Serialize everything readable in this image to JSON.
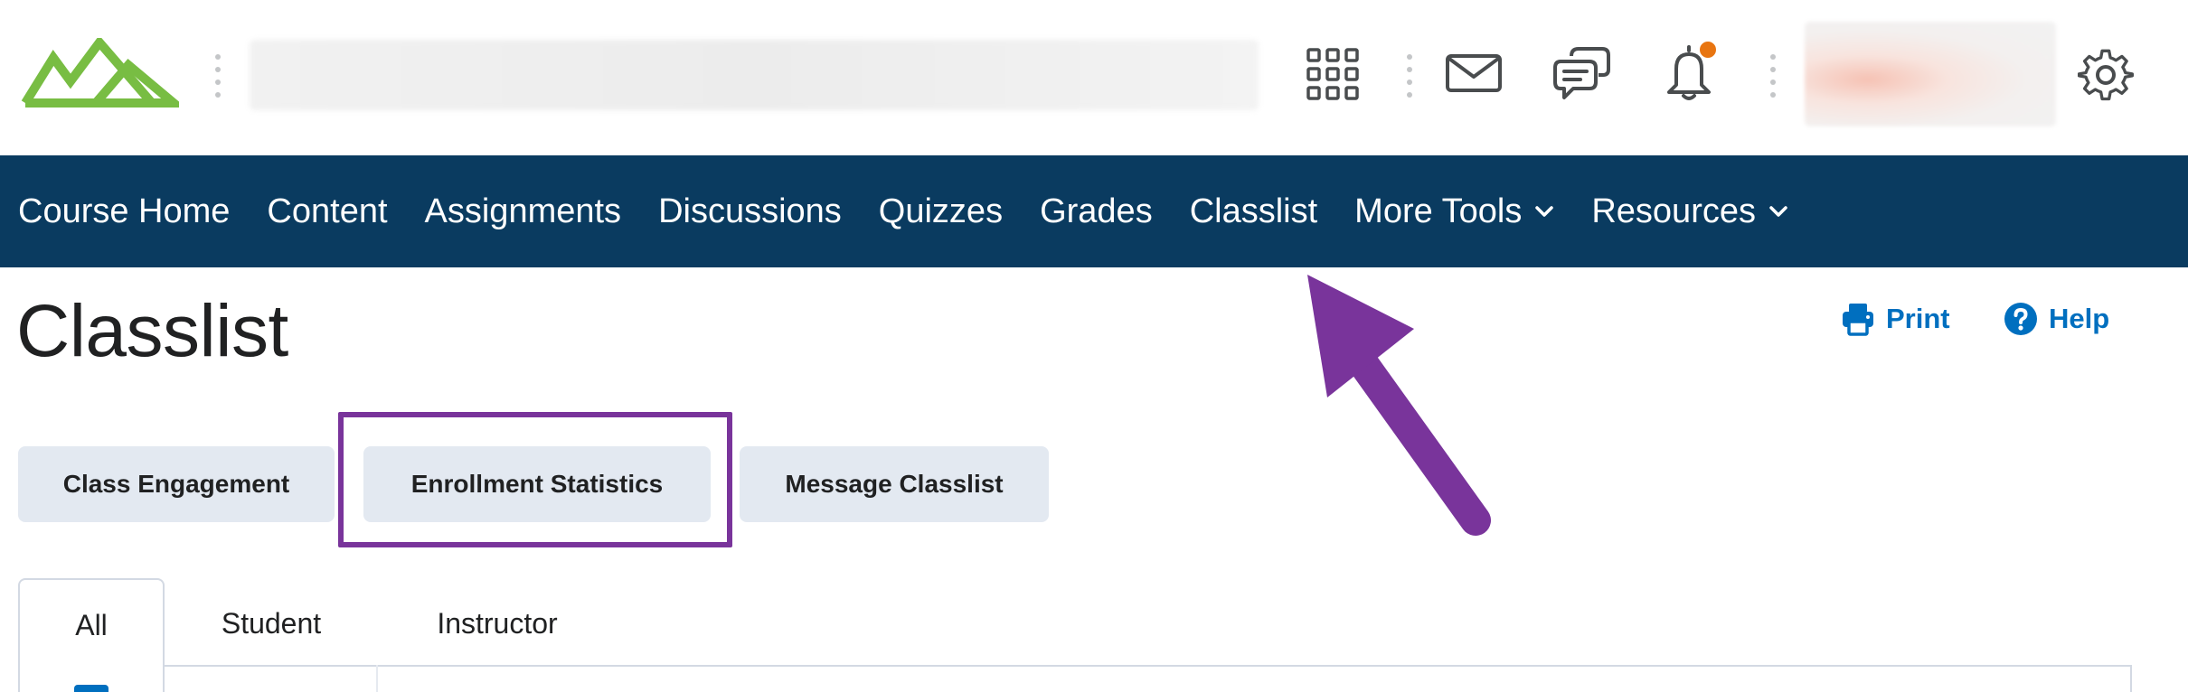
{
  "nav": {
    "items": [
      {
        "label": "Course Home",
        "dropdown": false
      },
      {
        "label": "Content",
        "dropdown": false
      },
      {
        "label": "Assignments",
        "dropdown": false
      },
      {
        "label": "Discussions",
        "dropdown": false
      },
      {
        "label": "Quizzes",
        "dropdown": false
      },
      {
        "label": "Grades",
        "dropdown": false
      },
      {
        "label": "Classlist",
        "dropdown": false
      },
      {
        "label": "More Tools",
        "dropdown": true
      },
      {
        "label": "Resources",
        "dropdown": true
      }
    ]
  },
  "page": {
    "title": "Classlist",
    "print_label": "Print",
    "help_label": "Help"
  },
  "actions": {
    "class_engagement": "Class Engagement",
    "enrollment_statistics": "Enrollment Statistics",
    "message_classlist": "Message Classlist"
  },
  "tabs": [
    {
      "label": "All",
      "active": true
    },
    {
      "label": "Student",
      "active": false
    },
    {
      "label": "Instructor",
      "active": false
    }
  ],
  "colors": {
    "navbar": "#0a3b60",
    "link": "#006fbf",
    "annotation": "#79349b",
    "logo": "#78bd43",
    "notification": "#e87511",
    "button_bg": "#e3e9f1"
  },
  "icons": {
    "logo": "mountain-logo-icon",
    "waffle": "waffle-grid-icon",
    "mail": "mail-icon",
    "chat": "chat-bubbles-icon",
    "bell": "bell-icon",
    "settings": "gear-icon",
    "print": "printer-icon",
    "help": "help-circle-icon",
    "dropdown": "chevron-down-icon"
  }
}
